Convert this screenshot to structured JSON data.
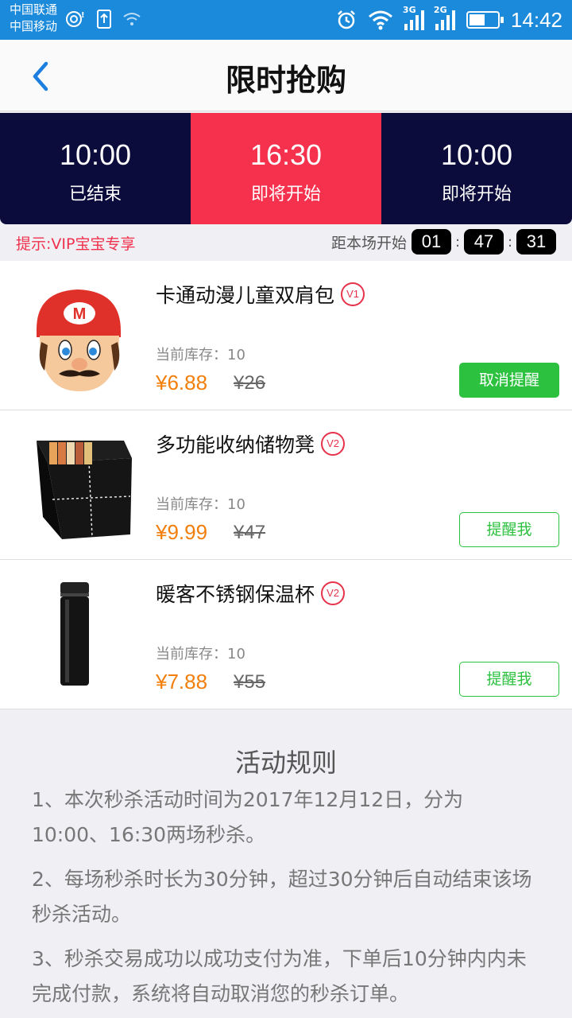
{
  "status_bar": {
    "carrier1": "中国联通",
    "carrier2": "中国移动",
    "net1": "3G",
    "net2": "2G",
    "time": "14:42",
    "battery_level": 0.55
  },
  "nav": {
    "title": "限时抢购"
  },
  "tabs": [
    {
      "time": "10:00",
      "status": "已结束",
      "active": false
    },
    {
      "time": "16:30",
      "status": "即将开始",
      "active": true
    },
    {
      "time": "10:00",
      "status": "即将开始",
      "active": false
    }
  ],
  "hint": "提示:VIP宝宝专享",
  "countdown": {
    "label": "距本场开始",
    "hours": "01",
    "minutes": "47",
    "seconds": "31"
  },
  "products": [
    {
      "name": "卡通动漫儿童双肩包",
      "badge": "V1",
      "stock": "当前库存：10",
      "price": "¥6.88",
      "original_price": "¥26",
      "button": "取消提醒",
      "button_style": "filled",
      "image": "mario-backpack-icon"
    },
    {
      "name": "多功能收纳储物凳",
      "badge": "V2",
      "stock": "当前库存：10",
      "price": "¥9.99",
      "original_price": "¥47",
      "button": "提醒我",
      "button_style": "outline",
      "image": "storage-stool-icon"
    },
    {
      "name": "暖客不锈钢保温杯",
      "badge": "V2",
      "stock": "当前库存：10",
      "price": "¥7.88",
      "original_price": "¥55",
      "button": "提醒我",
      "button_style": "outline",
      "image": "thermos-cup-icon"
    }
  ],
  "rules": {
    "title": "活动规则",
    "items": [
      "1、本次秒杀活动时间为2017年12月12日，分为10:00、16:30两场秒杀。",
      "2、每场秒杀时长为30分钟，超过30分钟后自动结束该场秒杀活动。",
      "3、秒杀交易成功以成功支付为准，下单后10分钟内内未完成付款，系统将自动取消您的秒杀订单。"
    ]
  },
  "colors": {
    "status_bar": "#1c8adb",
    "tab_bg": "#0c0c3c",
    "tab_active": "#f5314d",
    "green": "#2cc13f",
    "price": "#f27f0c"
  }
}
